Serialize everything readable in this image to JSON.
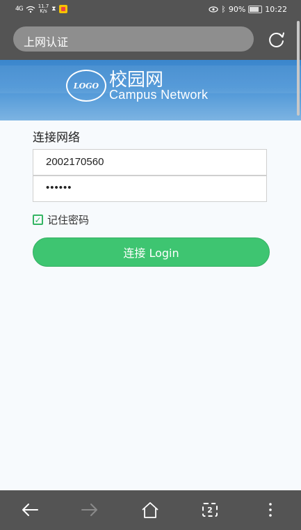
{
  "status_bar": {
    "signal": "4G",
    "net_speed_value": "11.7",
    "net_speed_unit": "K/s",
    "battery_percent": "90%",
    "time": "10:22"
  },
  "browser": {
    "url_title": "上网认证"
  },
  "banner": {
    "logo_text": "LOGO",
    "title": "校园网",
    "subtitle": "Campus Network"
  },
  "form": {
    "title": "连接网络",
    "username_value": "2002170560",
    "password_value": "••••••",
    "remember_label": "记住密码",
    "remember_checked": true,
    "login_label": "连接 Login"
  },
  "navbar": {
    "tabs_count": "2"
  },
  "colors": {
    "accent": "#3ec571",
    "banner": "#4a94d6",
    "chrome": "#545454"
  }
}
